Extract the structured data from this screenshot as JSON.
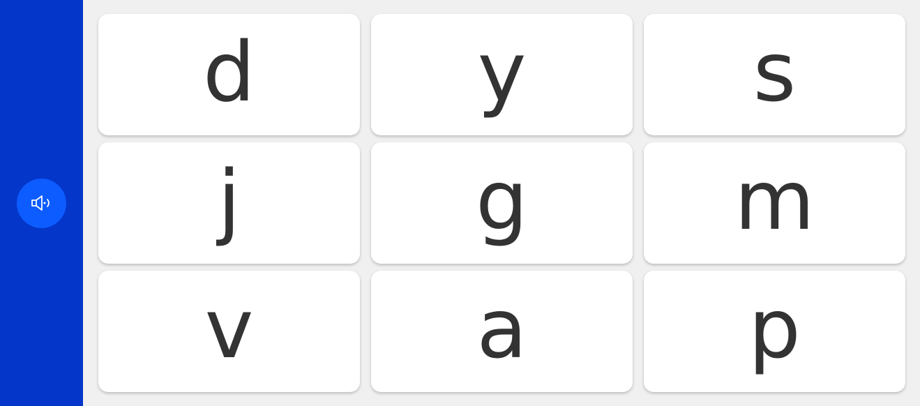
{
  "sidebar": {
    "sound_icon": "speaker-sound-icon",
    "accent_color": "#0336c9",
    "button_color": "#0d5cff"
  },
  "cards": [
    {
      "letter": "d"
    },
    {
      "letter": "y"
    },
    {
      "letter": "s"
    },
    {
      "letter": "j"
    },
    {
      "letter": "g"
    },
    {
      "letter": "m"
    },
    {
      "letter": "v"
    },
    {
      "letter": "a"
    },
    {
      "letter": "p"
    }
  ]
}
